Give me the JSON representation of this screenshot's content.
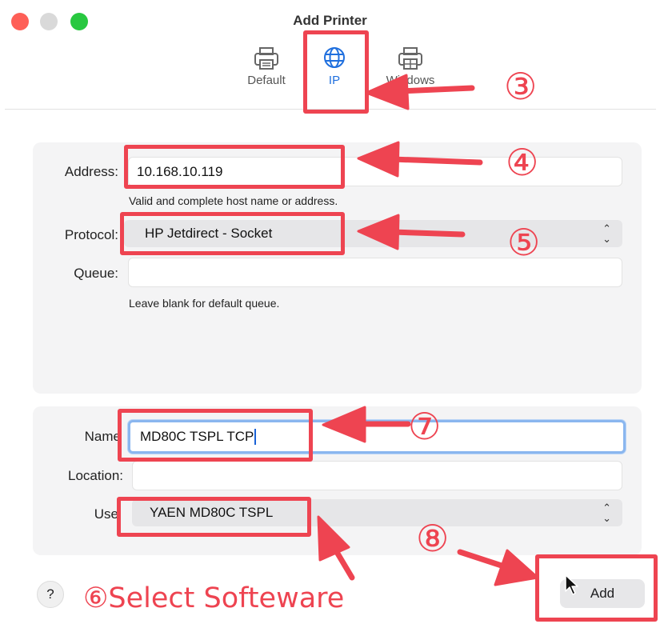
{
  "window": {
    "title": "Add Printer",
    "tabs": [
      {
        "label": "Default",
        "icon": "printer-icon"
      },
      {
        "label": "IP",
        "icon": "globe-icon"
      },
      {
        "label": "Windows",
        "icon": "printer-icon"
      }
    ],
    "help_label": "?"
  },
  "ip_panel": {
    "address": {
      "label": "Address:",
      "value": "10.168.10.119",
      "hint": "Valid and complete host name or address."
    },
    "protocol": {
      "label": "Protocol:",
      "value": "HP Jetdirect - Socket"
    },
    "queue": {
      "label": "Queue:",
      "value": "",
      "hint": "Leave blank for default queue."
    }
  },
  "info_panel": {
    "name": {
      "label": "Name",
      "value": "MD80C TSPL TCP"
    },
    "location": {
      "label": "Location:",
      "value": ""
    },
    "use": {
      "label": "Use",
      "value": "YAEN MD80C TSPL"
    }
  },
  "buttons": {
    "add": "Add"
  },
  "annotations": {
    "step3": "③",
    "step4": "④",
    "step5": "⑤",
    "step7": "⑦",
    "step8": "⑧",
    "step6_caption": "⑥Select Softeware",
    "color": "#ee4451"
  }
}
